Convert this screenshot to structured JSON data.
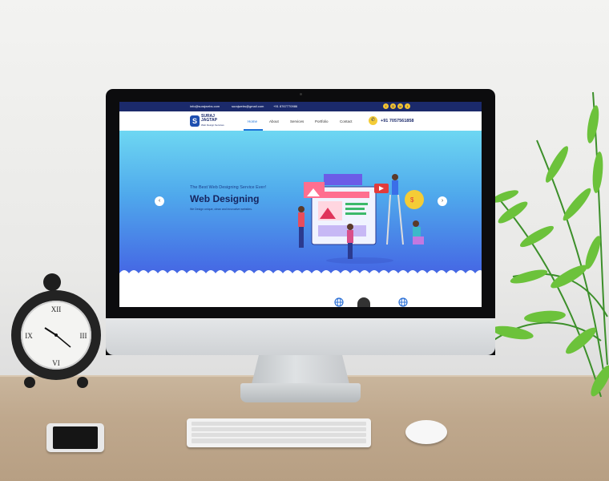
{
  "website": {
    "topbar": {
      "email_1": "info@surajwebs.com",
      "email_2": "surajwebs@gmail.com",
      "phone": "+91 8767770986",
      "social_icons": [
        "facebook-icon",
        "instagram-icon",
        "linkedin-icon",
        "twitter-icon"
      ]
    },
    "brand": {
      "name_line1": "SURAJ",
      "name_line2": "JAGTAP",
      "tagline": "Web Design Services"
    },
    "nav": {
      "items": [
        "Home",
        "About",
        "Services",
        "Portfolio",
        "Contact"
      ],
      "active": "Home",
      "phone": "+91 7057561858"
    },
    "hero": {
      "subtitle": "The Best Web Designing Service Ever!",
      "title": "Web Designing",
      "description": "We Design unique, clean and innovative websites.",
      "prev_arrow": "‹",
      "next_arrow": "›"
    }
  },
  "colors": {
    "topbar": "#1b2a6b",
    "accent": "#1e73d8",
    "badge": "#f4cc36",
    "hero_top": "#6ed7f2",
    "hero_bottom": "#4567e4"
  }
}
